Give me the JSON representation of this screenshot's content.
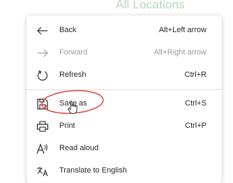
{
  "background": {
    "title": "All Locations",
    "title_color": "#b7d8bd"
  },
  "menu": {
    "items": [
      {
        "label": "Back",
        "shortcut": "Alt+Left arrow",
        "icon": "back-arrow-icon",
        "enabled": true
      },
      {
        "label": "Forward",
        "shortcut": "Alt+Right arrow",
        "icon": "forward-arrow-icon",
        "enabled": false
      },
      {
        "label": "Refresh",
        "shortcut": "Ctrl+R",
        "icon": "refresh-icon",
        "enabled": true
      },
      {
        "label": "Save as",
        "shortcut": "Ctrl+S",
        "icon": "save-icon",
        "enabled": true
      },
      {
        "label": "Print",
        "shortcut": "Ctrl+P",
        "icon": "print-icon",
        "enabled": true
      },
      {
        "label": "Read aloud",
        "shortcut": "",
        "icon": "read-aloud-icon",
        "enabled": true
      },
      {
        "label": "Translate to English",
        "shortcut": "",
        "icon": "translate-icon",
        "enabled": true
      }
    ]
  },
  "annotation": {
    "highlight_color": "#d9534f"
  }
}
